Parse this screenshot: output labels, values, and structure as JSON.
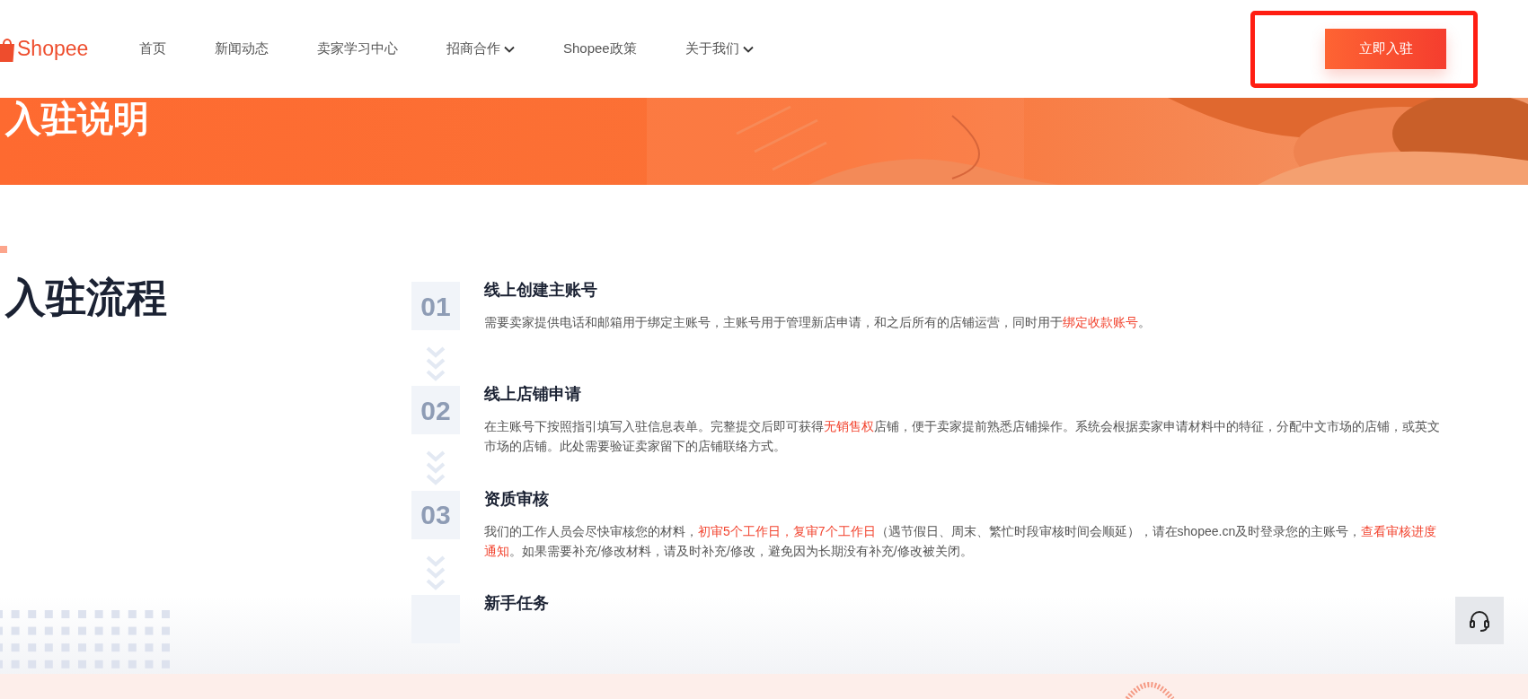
{
  "header": {
    "logo": "Shopee",
    "nav": [
      {
        "label": "首页",
        "dropdown": false
      },
      {
        "label": "新闻动态",
        "dropdown": false
      },
      {
        "label": "卖家学习中心",
        "dropdown": false
      },
      {
        "label": "招商合作",
        "dropdown": true
      },
      {
        "label": "Shopee政策",
        "dropdown": false
      },
      {
        "label": "关于我们",
        "dropdown": true
      }
    ],
    "cta": "立即入驻",
    "cta_highlighted": true
  },
  "banner": {
    "title": "入驻说明"
  },
  "process": {
    "heading": "入驻流程",
    "steps": [
      {
        "number": "01",
        "title": "线上创建主账号",
        "description": [
          {
            "text": "需要卖家提供电话和邮箱用于绑定主账号，主账号用于管理新店申请，和之后所有的店铺运营，同时用于",
            "highlight": false
          },
          {
            "text": "绑定收款账号",
            "highlight": true
          },
          {
            "text": "。",
            "highlight": false
          }
        ]
      },
      {
        "number": "02",
        "title": "线上店铺申请",
        "description": [
          {
            "text": "在主账号下按照指引填写入驻信息表单。完整提交后即可获得",
            "highlight": false
          },
          {
            "text": "无销售权",
            "highlight": true
          },
          {
            "text": "店铺，便于卖家提前熟悉店铺操作。系统会根据卖家申请材料中的特征，分配中文市场的店铺，或英文市场的店铺。此处需要验证卖家留下的店铺联络方式。",
            "highlight": false
          }
        ]
      },
      {
        "number": "03",
        "title": "资质审核",
        "description": [
          {
            "text": "我们的工作人员会尽快审核您的材料，",
            "highlight": false
          },
          {
            "text": "初审5个工作日，复审7个工作日",
            "highlight": true
          },
          {
            "text": "（遇节假日、周末、繁忙时段审核时间会顺延），请在shopee.cn及时登录您的主账号，",
            "highlight": false
          },
          {
            "text": "查看审核进度通知",
            "highlight": true
          },
          {
            "text": "。如果需要补充/修改材料，请及时补充/修改，避免因为长期没有补充/修改被关闭。",
            "highlight": false
          }
        ]
      },
      {
        "title": "新手任务"
      }
    ]
  }
}
